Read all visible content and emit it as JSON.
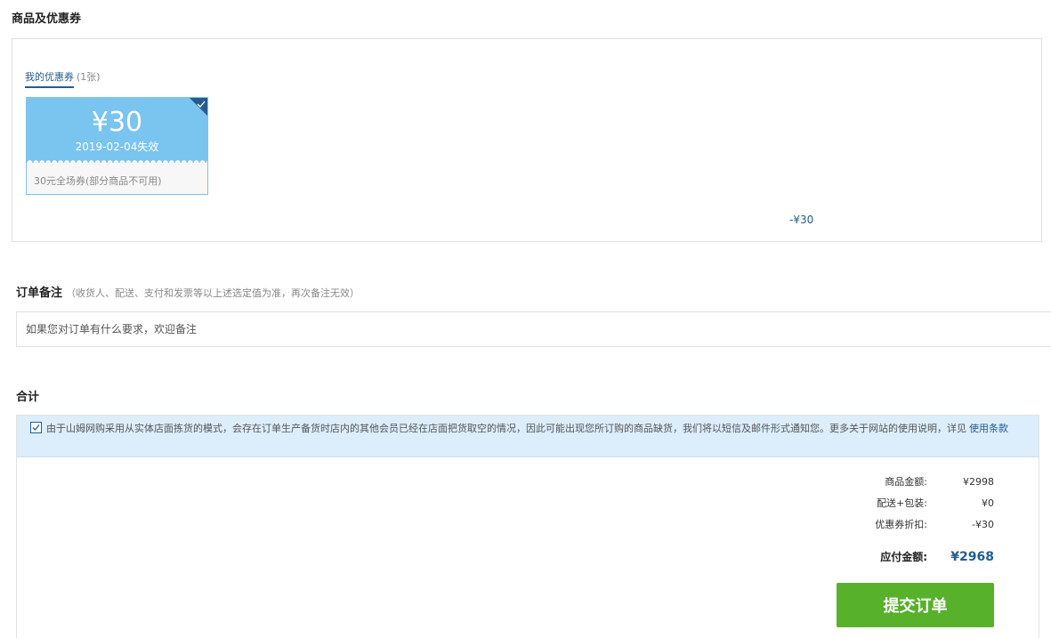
{
  "goods_section": {
    "title": "商品及优惠券"
  },
  "coupons": {
    "tab_label": "我的优惠券",
    "tab_count": "(1张)",
    "card": {
      "amount": "¥30",
      "expiry": "2019-02-04失效",
      "description": "30元全场券(部分商品不可用)",
      "selected": true
    },
    "discount_applied": "-¥30",
    "colors": {
      "card": "#7ac4f0",
      "accent": "#245b91"
    }
  },
  "remark": {
    "title": "订单备注",
    "hint": "（收货人、配送、支付和发票等以上述选定值为准，再次备注无效）",
    "placeholder": "如果您对订单有什么要求，欢迎备注"
  },
  "total": {
    "title": "合计",
    "notice": {
      "checked": true,
      "text": "由于山姆网购采用从实体店面拣货的模式，会存在订单生产备货时店内的其他会员已经在店面把货取空的情况，因此可能出现您所订购的商品缺货，我们将以短信及邮件形式通知您。更多关于网站的使用说明，详见",
      "link_label": "使用条款"
    },
    "summary": [
      {
        "label": "商品金额:",
        "value": "¥2998"
      },
      {
        "label": "配送+包装:",
        "value": "¥0"
      },
      {
        "label": "优惠券折扣:",
        "value": "-¥30"
      }
    ],
    "payable_label": "应付金额:",
    "payable_value": "¥2968",
    "submit_label": "提交订单",
    "colors": {
      "submit": "#57b12a",
      "notice_bg": "#dcedfc"
    }
  }
}
